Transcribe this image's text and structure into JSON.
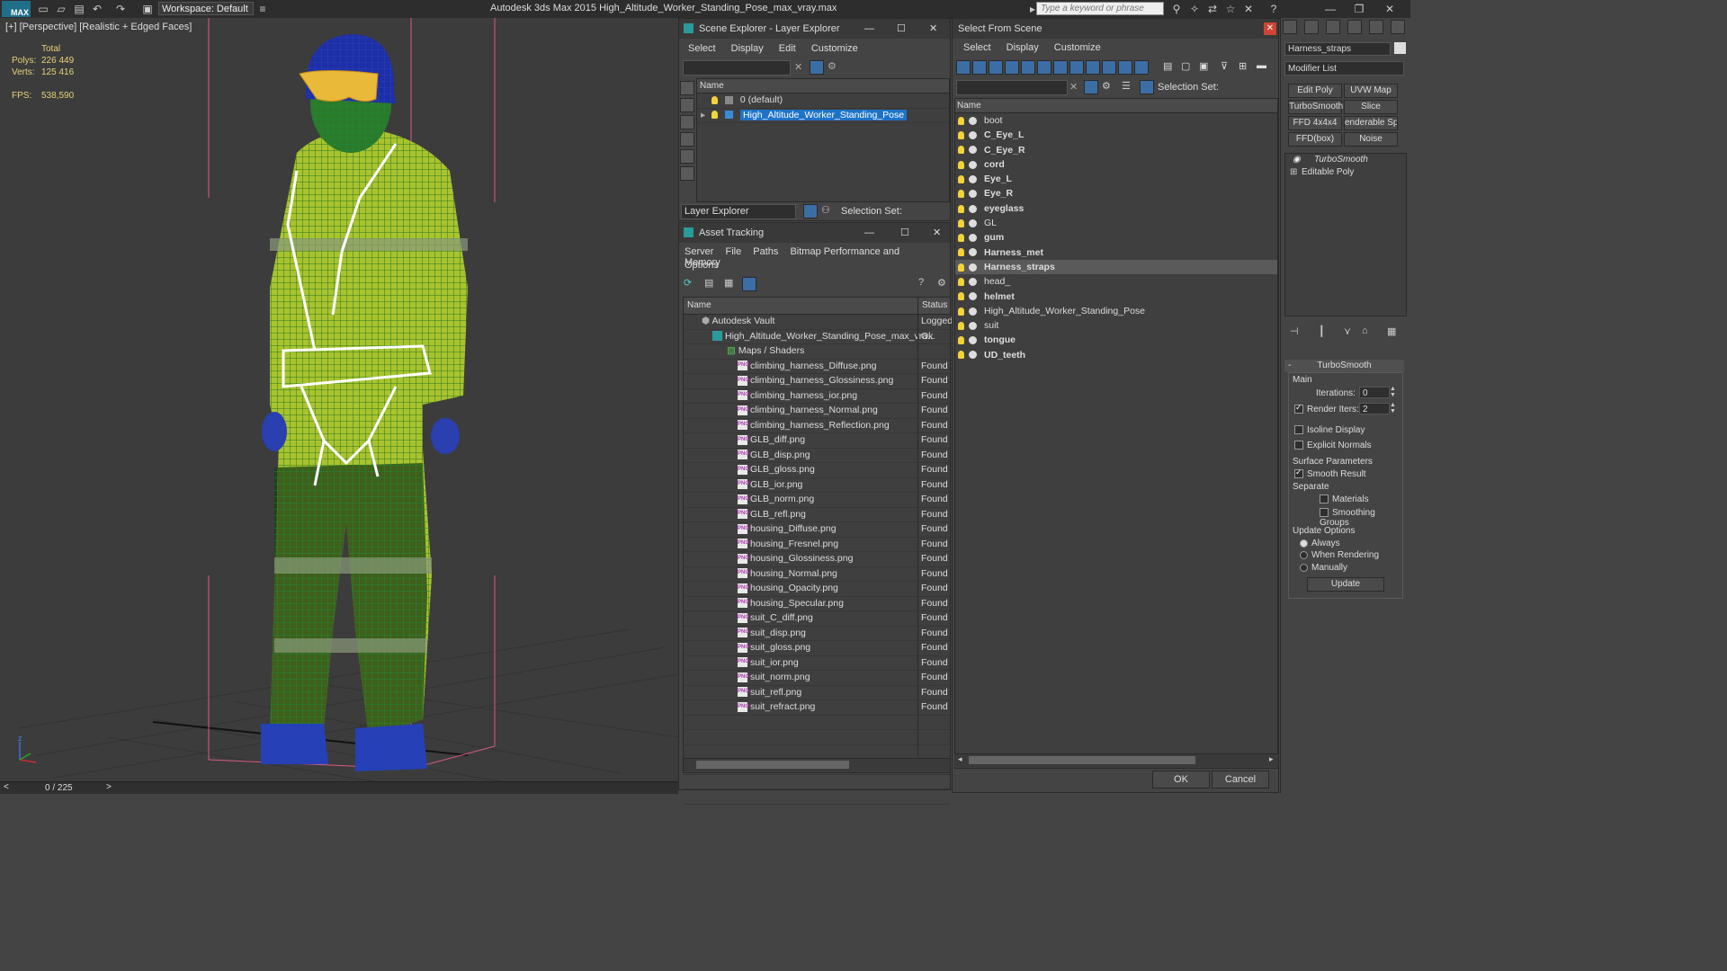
{
  "titlebar": {
    "logo": "MAX",
    "workspace": "Workspace: Default",
    "app_title": "Autodesk 3ds Max  2015     High_Altitude_Worker_Standing_Pose_max_vray.max",
    "search_placeholder": "Type a keyword or phrase"
  },
  "viewport": {
    "label": "[+] [Perspective] [Realistic + Edged Faces]",
    "stats": {
      "total_label": "Total",
      "polys_label": "Polys:",
      "polys_value": "226 449",
      "verts_label": "Verts:",
      "verts_value": "125 416",
      "fps_label": "FPS:",
      "fps_value": "538,590"
    },
    "axis": {
      "z": "z"
    }
  },
  "timeline": {
    "counter": "0 / 225",
    "prev": "<",
    "next": ">"
  },
  "scene_explorer": {
    "title": "Scene Explorer - Layer Explorer",
    "menu": [
      "Select",
      "Display",
      "Edit",
      "Customize"
    ],
    "column": "Name",
    "layers": [
      {
        "name": "0 (default)",
        "selected": false
      },
      {
        "name": "High_Altitude_Worker_Standing_Pose",
        "selected": true
      }
    ],
    "footer_dropdown": "Layer Explorer",
    "selection_set_label": "Selection Set:"
  },
  "asset_tracking": {
    "title": "Asset Tracking",
    "menu": [
      "Server",
      "File",
      "Paths",
      "Bitmap Performance and Memory"
    ],
    "menu2": [
      "Options"
    ],
    "col_name": "Name",
    "col_status": "Status",
    "vault": {
      "name": "Autodesk Vault",
      "status": "Logged"
    },
    "file": {
      "name": "High_Altitude_Worker_Standing_Pose_max_vra...",
      "status": "Ok"
    },
    "folder": "Maps / Shaders",
    "maps": [
      {
        "name": "climbing_harness_Diffuse.png",
        "status": "Found"
      },
      {
        "name": "climbing_harness_Glossiness.png",
        "status": "Found"
      },
      {
        "name": "climbing_harness_ior.png",
        "status": "Found"
      },
      {
        "name": "climbing_harness_Normal.png",
        "status": "Found"
      },
      {
        "name": "climbing_harness_Reflection.png",
        "status": "Found"
      },
      {
        "name": "GLB_diff.png",
        "status": "Found"
      },
      {
        "name": "GLB_disp.png",
        "status": "Found"
      },
      {
        "name": "GLB_gloss.png",
        "status": "Found"
      },
      {
        "name": "GLB_ior.png",
        "status": "Found"
      },
      {
        "name": "GLB_norm.png",
        "status": "Found"
      },
      {
        "name": "GLB_refl.png",
        "status": "Found"
      },
      {
        "name": "housing_Diffuse.png",
        "status": "Found"
      },
      {
        "name": "housing_Fresnel.png",
        "status": "Found"
      },
      {
        "name": "housing_Glossiness.png",
        "status": "Found"
      },
      {
        "name": "housing_Normal.png",
        "status": "Found"
      },
      {
        "name": "housing_Opacity.png",
        "status": "Found"
      },
      {
        "name": "housing_Specular.png",
        "status": "Found"
      },
      {
        "name": "suit_C_diff.png",
        "status": "Found"
      },
      {
        "name": "suit_disp.png",
        "status": "Found"
      },
      {
        "name": "suit_gloss.png",
        "status": "Found"
      },
      {
        "name": "suit_ior.png",
        "status": "Found"
      },
      {
        "name": "suit_norm.png",
        "status": "Found"
      },
      {
        "name": "suit_refl.png",
        "status": "Found"
      },
      {
        "name": "suit_refract.png",
        "status": "Found"
      }
    ],
    "png_badge": "PNG"
  },
  "select_from_scene": {
    "title": "Select From Scene",
    "menu": [
      "Select",
      "Display",
      "Customize"
    ],
    "selection_set_label": "Selection Set:",
    "column": "Name",
    "objects": [
      {
        "name": "boot",
        "bold": false,
        "selected": false
      },
      {
        "name": "C_Eye_L",
        "bold": true,
        "selected": false
      },
      {
        "name": "C_Eye_R",
        "bold": true,
        "selected": false
      },
      {
        "name": "cord",
        "bold": true,
        "selected": false
      },
      {
        "name": "Eye_L",
        "bold": true,
        "selected": false
      },
      {
        "name": "Eye_R",
        "bold": true,
        "selected": false
      },
      {
        "name": "eyeglass",
        "bold": true,
        "selected": false
      },
      {
        "name": "GL",
        "bold": false,
        "selected": false
      },
      {
        "name": "gum",
        "bold": true,
        "selected": false
      },
      {
        "name": "Harness_met",
        "bold": true,
        "selected": false
      },
      {
        "name": "Harness_straps",
        "bold": true,
        "selected": true
      },
      {
        "name": "head_",
        "bold": false,
        "selected": false
      },
      {
        "name": "helmet",
        "bold": true,
        "selected": false
      },
      {
        "name": "High_Altitude_Worker_Standing_Pose",
        "bold": false,
        "selected": false
      },
      {
        "name": "suit",
        "bold": false,
        "selected": false
      },
      {
        "name": "tongue",
        "bold": true,
        "selected": false
      },
      {
        "name": "UD_teeth",
        "bold": true,
        "selected": false
      }
    ],
    "ok": "OK",
    "cancel": "Cancel"
  },
  "command_panel": {
    "object_name": "Harness_straps",
    "modifier_list": "Modifier List",
    "buttons": [
      "Edit Poly",
      "UVW Map",
      "TurboSmooth",
      "Slice",
      "FFD 4x4x4",
      "enderable Splin",
      "FFD(box)",
      "Noise"
    ],
    "stack": [
      "TurboSmooth",
      "Editable Poly"
    ],
    "rollout_title": "TurboSmooth",
    "main_label": "Main",
    "iterations_label": "Iterations:",
    "iterations_value": "0",
    "render_iters_label": "Render Iters:",
    "render_iters_value": "2",
    "isoline": "Isoline Display",
    "explicit_normals": "Explicit Normals",
    "surface_params": "Surface Parameters",
    "smooth_result": "Smooth Result",
    "separate": "Separate",
    "materials": "Materials",
    "smoothing_groups": "Smoothing Groups",
    "update_options": "Update Options",
    "always": "Always",
    "when_rendering": "When Rendering",
    "manually": "Manually",
    "update_button": "Update"
  },
  "colors": {
    "selected_blue": "#1e73c8",
    "found_text": "#dddddd"
  }
}
